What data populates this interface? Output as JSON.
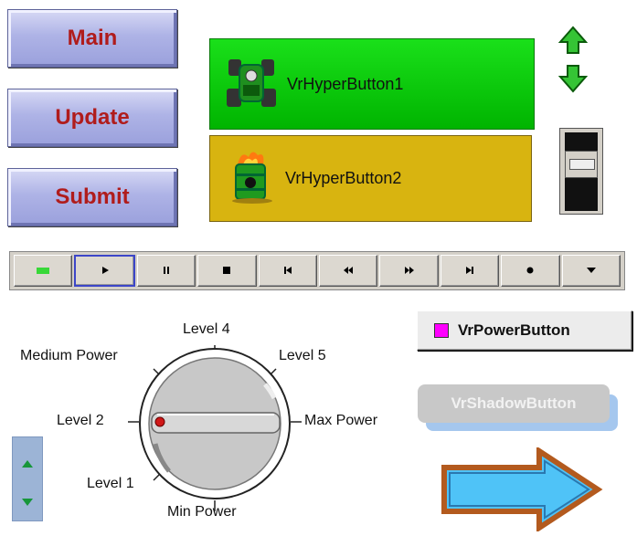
{
  "buttons": {
    "main": "Main",
    "update": "Update",
    "submit": "Submit"
  },
  "hyper_buttons": [
    {
      "label": "VrHyperButton1",
      "icon": "race-car-icon",
      "color": "#00c800"
    },
    {
      "label": "VrHyperButton2",
      "icon": "flaming-barrel-icon",
      "color": "#d8b410"
    }
  ],
  "media_bar": {
    "buttons": [
      {
        "name": "led",
        "icon": "green-led-icon"
      },
      {
        "name": "play",
        "icon": "play-icon"
      },
      {
        "name": "pause",
        "icon": "pause-icon"
      },
      {
        "name": "stop",
        "icon": "stop-icon"
      },
      {
        "name": "skip-back",
        "icon": "skip-back-icon"
      },
      {
        "name": "rewind",
        "icon": "rewind-icon"
      },
      {
        "name": "fast-forward",
        "icon": "fast-forward-icon"
      },
      {
        "name": "skip-forward",
        "icon": "skip-forward-icon"
      },
      {
        "name": "record",
        "icon": "record-icon"
      },
      {
        "name": "eject",
        "icon": "eject-icon"
      }
    ]
  },
  "knob": {
    "labels": {
      "level4": "Level 4",
      "medium_power": "Medium Power",
      "level5": "Level 5",
      "level2": "Level 2",
      "max_power": "Max Power",
      "level1": "Level 1",
      "min_power": "Min Power"
    },
    "selected": "Level 2"
  },
  "power_button": {
    "label": "VrPowerButton",
    "led_color": "#ff00ff"
  },
  "shadow_button": {
    "label": "VrShadowButton"
  },
  "arrow": {
    "fill": "#4fc3f7",
    "outline": "#b35a1e"
  }
}
